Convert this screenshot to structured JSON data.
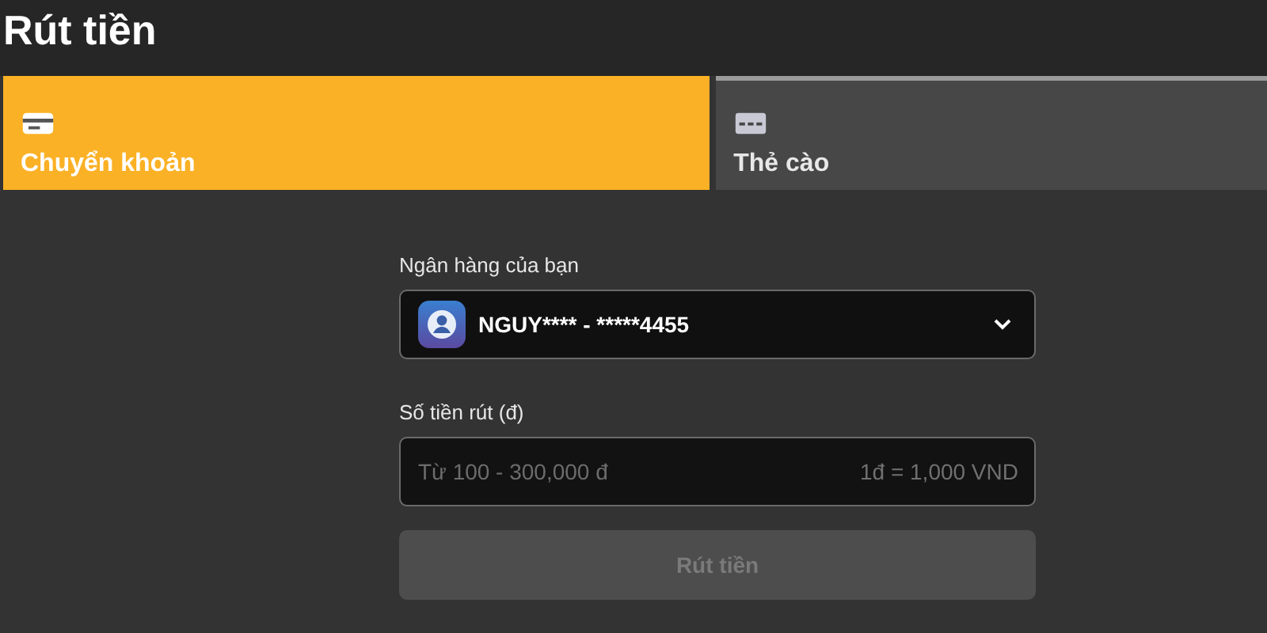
{
  "title": "Rút tiền",
  "tabs": [
    {
      "label": "Chuyển khoản",
      "kind": "card",
      "selected": true
    },
    {
      "label": "Thẻ cào",
      "kind": "scratch",
      "selected": false
    }
  ],
  "bank": {
    "label": "Ngân hàng của bạn",
    "value": "NGUY**** - *****4455"
  },
  "amount": {
    "label": "Số tiền rút (đ)",
    "placeholder": "Từ 100 - 300,000 đ",
    "rate": "1đ = 1,000 VND"
  },
  "submit": {
    "label": "Rút tiền",
    "disabled": true
  }
}
